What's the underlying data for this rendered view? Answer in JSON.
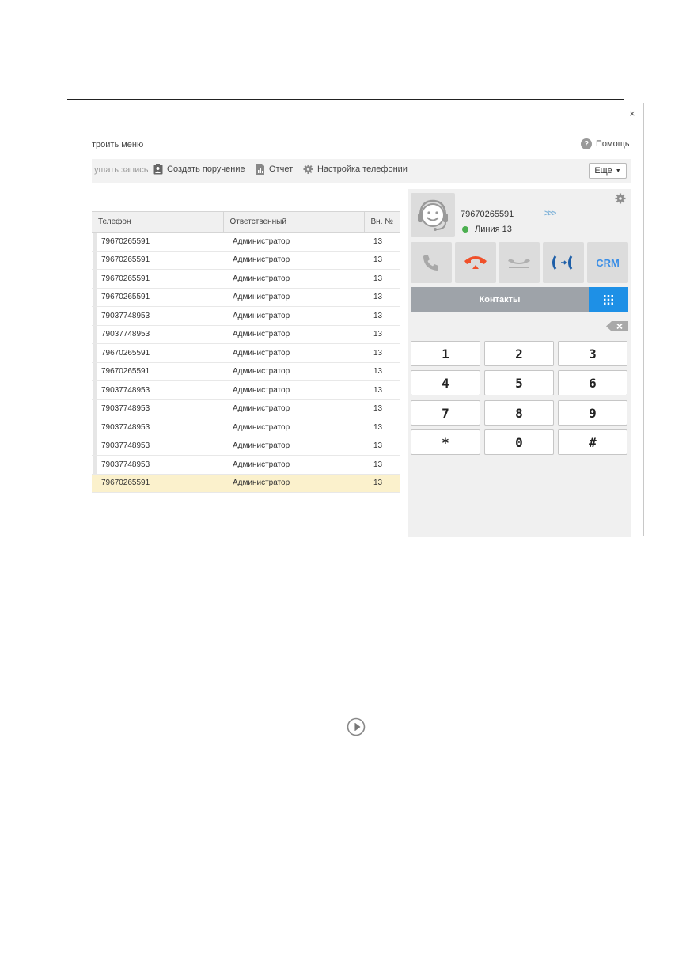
{
  "window": {
    "close_label": "×"
  },
  "menu": {
    "setup_label": "троить меню",
    "help_label": "Помощь"
  },
  "toolbar": {
    "listen_label": "ушать запись",
    "task_label": "Создать поручение",
    "report_label": "Отчет",
    "settings_label": "Настройка телефонии",
    "more_label": "Еще"
  },
  "table": {
    "headers": [
      "Телефон",
      "Ответственный",
      "Вн. №"
    ],
    "rows": [
      [
        "79670265591",
        "Администратор",
        "13"
      ],
      [
        "79670265591",
        "Администратор",
        "13"
      ],
      [
        "79670265591",
        "Администратор",
        "13"
      ],
      [
        "79670265591",
        "Администратор",
        "13"
      ],
      [
        "79037748953",
        "Администратор",
        "13"
      ],
      [
        "79037748953",
        "Администратор",
        "13"
      ],
      [
        "79670265591",
        "Администратор",
        "13"
      ],
      [
        "79670265591",
        "Администратор",
        "13"
      ],
      [
        "79037748953",
        "Администратор",
        "13"
      ],
      [
        "79037748953",
        "Администратор",
        "13"
      ],
      [
        "79037748953",
        "Администратор",
        "13"
      ],
      [
        "79037748953",
        "Администратор",
        "13"
      ],
      [
        "79037748953",
        "Администратор",
        "13"
      ],
      [
        "79670265591",
        "Администратор",
        "13"
      ]
    ],
    "selected_row_index": 13
  },
  "phone": {
    "caller_number": "79670265591",
    "line_label": "Линия 13",
    "forward_label": ">>>",
    "crm_label": "CRM",
    "contacts_label": "Контакты",
    "keys": [
      "1",
      "2",
      "3",
      "4",
      "5",
      "6",
      "7",
      "8",
      "9",
      "*",
      "0",
      "#"
    ]
  },
  "colors": {
    "accent_blue": "#1e90e6",
    "hangup_red": "#f0502a",
    "status_green": "#4caf50",
    "selected_row": "#fbf1cc"
  }
}
